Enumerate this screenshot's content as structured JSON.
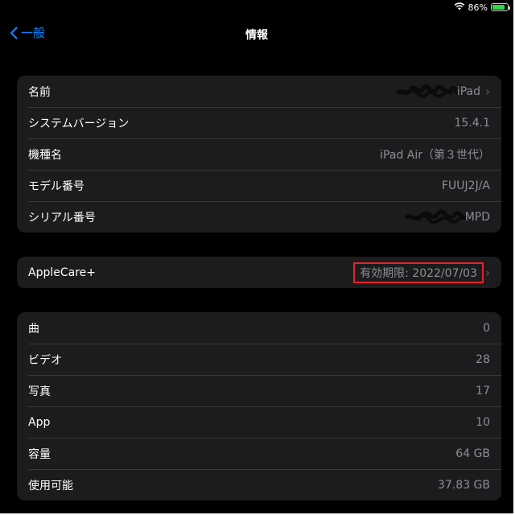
{
  "status": {
    "battery": "86%",
    "battery_level": 0.86
  },
  "nav": {
    "back_label": "一般",
    "title": "情報"
  },
  "groups": [
    [
      {
        "label": "名前",
        "value": "iPad"
      },
      {
        "label": "システムバージョン",
        "value": "15.4.1"
      },
      {
        "label": "機種名",
        "value": "iPad Air（第３世代）"
      },
      {
        "label": "モデル番号",
        "value": "FUUJ2J/A"
      },
      {
        "label": "シリアル番号",
        "value": "MPD"
      }
    ],
    [
      {
        "label": "AppleCare+",
        "value": "有効期限: 2022/07/03"
      }
    ],
    [
      {
        "label": "曲",
        "value": "0"
      },
      {
        "label": "ビデオ",
        "value": "28"
      },
      {
        "label": "写真",
        "value": "17"
      },
      {
        "label": "App",
        "value": "10"
      },
      {
        "label": "容量",
        "value": "64 GB"
      },
      {
        "label": "使用可能",
        "value": "37.83 GB"
      }
    ]
  ],
  "colors": {
    "accent": "#0a84ff",
    "highlight": "#e8222a",
    "battery": "#32d74b"
  }
}
